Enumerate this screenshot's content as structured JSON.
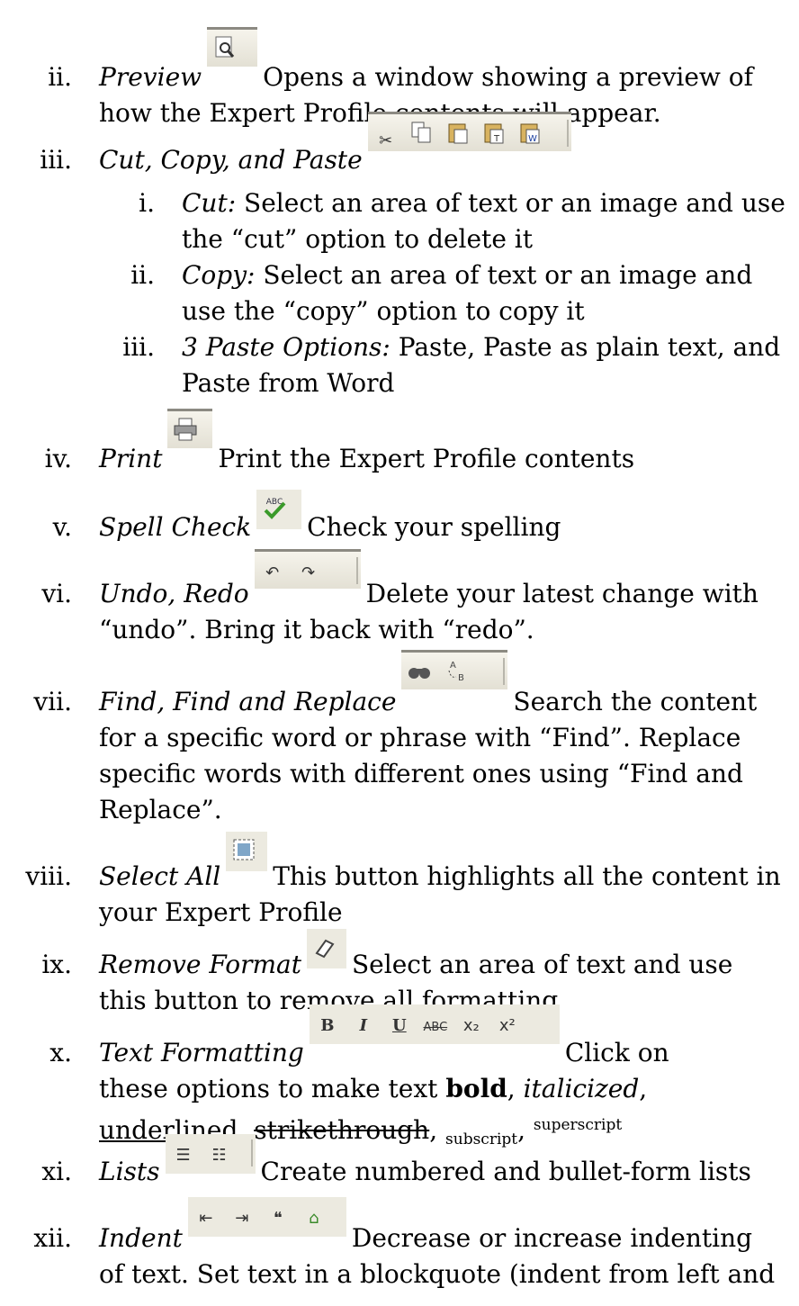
{
  "items": [
    {
      "num": "ii.",
      "term": "Preview",
      "text1": "Opens a window showing a preview of",
      "text2": "how the Expert Profile contents will appear."
    },
    {
      "num": "iii.",
      "term": "Cut, Copy, and Paste"
    },
    {
      "num": "iv.",
      "term": "Print",
      "text1": "Print the Expert Profile contents"
    },
    {
      "num": "v.",
      "term": "Spell Check",
      "text1": "Check your spelling"
    },
    {
      "num": "vi.",
      "term": "Undo, Redo",
      "text1": "Delete your latest change with",
      "text2": "“undo”. Bring it back with “redo”."
    },
    {
      "num": "vii.",
      "term": "Find, Find and Replace",
      "text1": "Search the content",
      "text2": "for a specific word or phrase with “Find”. Replace",
      "text3": "specific words with different ones using “Find and",
      "text4": "Replace”."
    },
    {
      "num": "viii.",
      "term": "Select All",
      "text1": "This button highlights all the content in",
      "text2": "your Expert Profile"
    },
    {
      "num": "ix.",
      "term": "Remove Format",
      "text1": "Select an area of text and use",
      "text2": "this button to remove all formatting"
    },
    {
      "num": "x.",
      "term": "Text Formatting",
      "text1": "Click on",
      "text2a": "these options to make text ",
      "bold": "bold",
      "italic": "italicized",
      "underline": "underlined",
      "strike": "strikethrough",
      "subscript": "subscript",
      "superscript": "superscript"
    },
    {
      "num": "xi.",
      "term": "Lists",
      "text1": "Create numbered and bullet-form lists"
    },
    {
      "num": "xii.",
      "term": "Indent",
      "text1": "Decrease or increase indenting",
      "text2": "of text. Set text in a blockquote (indent from left and"
    }
  ],
  "subitems": [
    {
      "num": "i.",
      "term": "Cut:",
      "text1": " Select an area of text or an image and use",
      "text2": "the “cut” option to delete it"
    },
    {
      "num": "ii.",
      "term": "Copy:",
      "text1": " Select an area of text or an image and",
      "text2": "use the “copy” option to copy it"
    },
    {
      "num": "iii.",
      "term": "3 Paste Options:",
      "text1": " Paste, Paste as plain text, and",
      "text2": "Paste from Word"
    }
  ],
  "toolbar_glyphs": {
    "bold": "B",
    "italic": "I",
    "underline": "U",
    "strike": "ABC",
    "subscript": "x₂",
    "superscript": "x²"
  },
  "icons": [
    "preview-icon",
    "cut-icon",
    "copy-icon",
    "paste-icon",
    "paste-text-icon",
    "paste-word-icon",
    "print-icon",
    "spell-check-icon",
    "undo-icon",
    "redo-icon",
    "find-icon",
    "replace-icon",
    "select-all-icon",
    "remove-format-icon",
    "bold-icon",
    "italic-icon",
    "underline-icon",
    "strikethrough-icon",
    "subscript-icon",
    "superscript-icon",
    "numbered-list-icon",
    "bullet-list-icon",
    "outdent-icon",
    "indent-icon",
    "blockquote-icon",
    "div-icon"
  ]
}
